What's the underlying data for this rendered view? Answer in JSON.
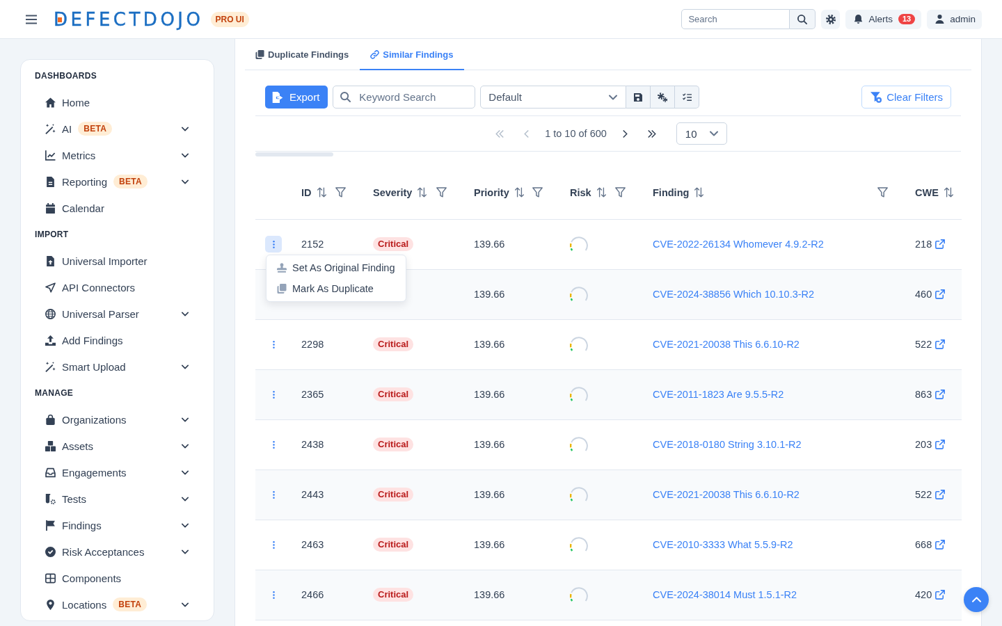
{
  "header": {
    "logo": "DEFECTDOJO",
    "edition_badge": "PRO UI",
    "search": {
      "placeholder": "Search"
    },
    "alerts": {
      "label": "Alerts",
      "count": "13"
    },
    "user": {
      "name": "admin"
    }
  },
  "sidebar": {
    "sections": [
      {
        "title": "DASHBOARDS",
        "items": [
          {
            "label": "Home",
            "expandable": false
          },
          {
            "label": "AI",
            "badge": "BETA",
            "expandable": true
          },
          {
            "label": "Metrics",
            "expandable": true
          },
          {
            "label": "Reporting",
            "badge": "BETA",
            "expandable": true
          },
          {
            "label": "Calendar",
            "expandable": false
          }
        ]
      },
      {
        "title": "IMPORT",
        "items": [
          {
            "label": "Universal Importer",
            "expandable": false
          },
          {
            "label": "API Connectors",
            "expandable": false
          },
          {
            "label": "Universal Parser",
            "expandable": true
          },
          {
            "label": "Add Findings",
            "expandable": false
          },
          {
            "label": "Smart Upload",
            "expandable": true
          }
        ]
      },
      {
        "title": "MANAGE",
        "items": [
          {
            "label": "Organizations",
            "expandable": true
          },
          {
            "label": "Assets",
            "expandable": true
          },
          {
            "label": "Engagements",
            "expandable": true
          },
          {
            "label": "Tests",
            "expandable": true
          },
          {
            "label": "Findings",
            "expandable": true
          },
          {
            "label": "Risk Acceptances",
            "expandable": true
          },
          {
            "label": "Components",
            "expandable": false
          },
          {
            "label": "Locations",
            "badge": "BETA",
            "expandable": true
          }
        ]
      }
    ]
  },
  "tabs": [
    {
      "label": "Duplicate Findings",
      "selected": false
    },
    {
      "label": "Similar Findings",
      "selected": true
    }
  ],
  "toolbar": {
    "export_button": "Export",
    "keyword_search": {
      "placeholder": "Keyword Search"
    },
    "view_select": {
      "value": "Default"
    },
    "clear_filters_button": "Clear Filters"
  },
  "pagination": {
    "buttons": [
      {
        "kind": "first",
        "disabled": true
      },
      {
        "kind": "previous",
        "disabled": true
      },
      {
        "kind": "next",
        "disabled": false
      },
      {
        "kind": "last",
        "disabled": false
      }
    ],
    "range": "1 to 10 of 600",
    "page_size": "10"
  },
  "table": {
    "columns": [
      {
        "label": "ID",
        "sortable": true,
        "filterable": true
      },
      {
        "label": "Severity",
        "sortable": true,
        "filterable": true
      },
      {
        "label": "Priority",
        "sortable": true,
        "filterable": true
      },
      {
        "label": "Risk",
        "sortable": true,
        "filterable": true
      },
      {
        "label": "Finding",
        "sortable": true,
        "filterable": true
      },
      {
        "label": "CWE",
        "sortable": true,
        "filterable": false
      }
    ],
    "row_menu": {
      "items": [
        {
          "label": "Set As Original Finding"
        },
        {
          "label": "Mark As Duplicate"
        }
      ]
    },
    "rows": [
      {
        "menu_open": true,
        "id": "2152",
        "severity": "Critical",
        "priority": "139.66",
        "finding": "CVE-2022-26134 Whomever 4.9.2-R2",
        "cwe": "218"
      },
      {
        "menu_open": false,
        "priority": "139.66",
        "finding": "CVE-2024-38856 Which 10.10.3-R2",
        "cwe": "460"
      },
      {
        "menu_open": false,
        "id": "2298",
        "severity": "Critical",
        "priority": "139.66",
        "finding": "CVE-2021-20038 This 6.6.10-R2",
        "cwe": "522"
      },
      {
        "menu_open": false,
        "id": "2365",
        "severity": "Critical",
        "priority": "139.66",
        "finding": "CVE-2011-1823 Are 9.5.5-R2",
        "cwe": "863"
      },
      {
        "menu_open": false,
        "id": "2438",
        "severity": "Critical",
        "priority": "139.66",
        "finding": "CVE-2018-0180 String 3.10.1-R2",
        "cwe": "203"
      },
      {
        "menu_open": false,
        "id": "2443",
        "severity": "Critical",
        "priority": "139.66",
        "finding": "CVE-2021-20038 This 6.6.10-R2",
        "cwe": "522"
      },
      {
        "menu_open": false,
        "id": "2463",
        "severity": "Critical",
        "priority": "139.66",
        "finding": "CVE-2010-3333 What 5.5.9-R2",
        "cwe": "668"
      },
      {
        "menu_open": false,
        "id": "2466",
        "severity": "Critical",
        "priority": "139.66",
        "finding": "CVE-2024-38014 Must 1.5.1-R2",
        "cwe": "420"
      }
    ]
  }
}
